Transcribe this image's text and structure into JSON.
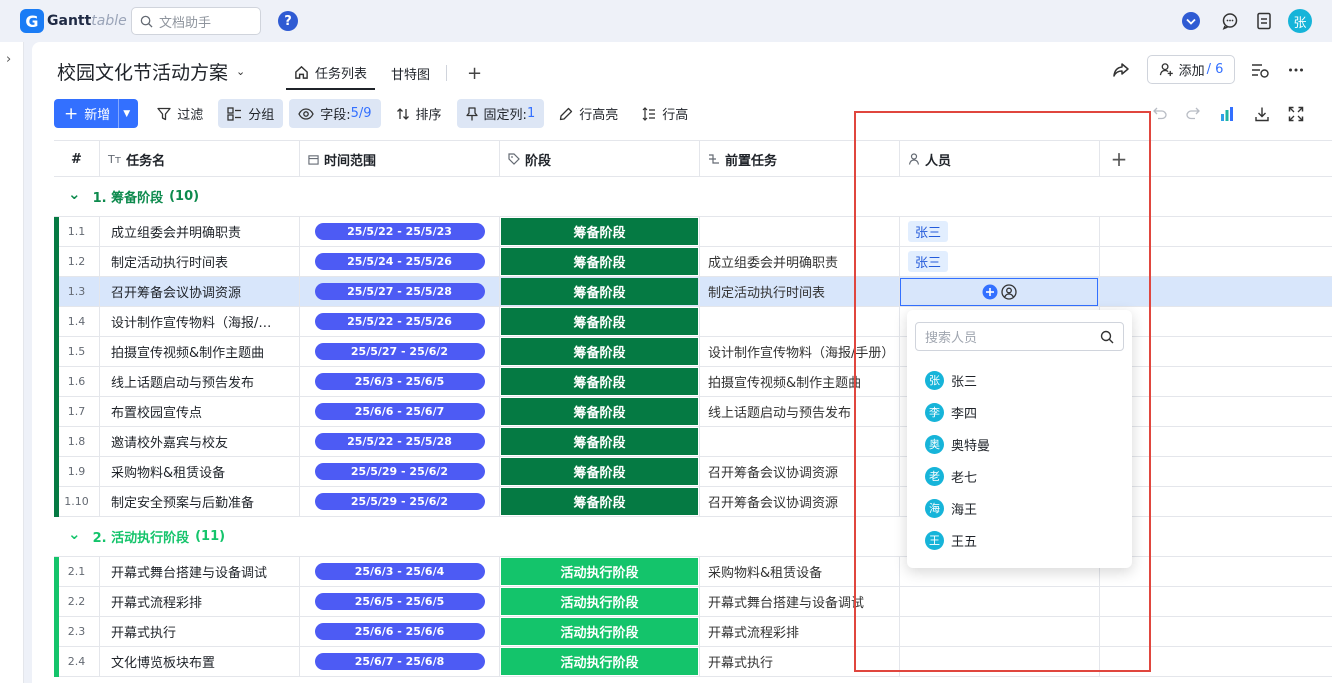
{
  "app": {
    "logo_letter": "G",
    "logo_part1": "Gantt",
    "logo_part2": "table",
    "search_placeholder": "文档助手",
    "help": "?",
    "user_avatar": "张"
  },
  "doc": {
    "title": "校园文化节活动方案",
    "tabs": [
      "任务列表",
      "甘特图"
    ],
    "add_label": "添加",
    "add_count": "/ 6"
  },
  "toolbar": {
    "new": "新增",
    "filter": "过滤",
    "group": "分组",
    "fields": "字段:",
    "fields_value": "5/9",
    "sort": "排序",
    "pin": "固定列:",
    "pin_value": "1",
    "row_highlight": "行高亮",
    "row_height": "行高"
  },
  "columns": [
    "#",
    "任务名",
    "时间范围",
    "阶段",
    "前置任务",
    "人员"
  ],
  "colors": {
    "stage1": "#057a43",
    "stage2": "#14c46b",
    "accent": "#3370ff",
    "date_pill": "#4d5bf4"
  },
  "groups": [
    {
      "label": "1. 筹备阶段",
      "count": "(10)",
      "color": "#0d8a4d"
    },
    {
      "label": "2. 活动执行阶段",
      "count": "(11)",
      "color": "#14c46b"
    }
  ],
  "rows": [
    {
      "idx": "1.1",
      "name": "成立组委会并明确职责",
      "time": "25/5/22 - 25/5/23",
      "stage": "筹备阶段",
      "pre": "",
      "person": "张三"
    },
    {
      "idx": "1.2",
      "name": "制定活动执行时间表",
      "time": "25/5/24 - 25/5/26",
      "stage": "筹备阶段",
      "pre": "成立组委会并明确职责",
      "person": "张三"
    },
    {
      "idx": "1.3",
      "name": "召开筹备会议协调资源",
      "time": "25/5/27 - 25/5/28",
      "stage": "筹备阶段",
      "pre": "制定活动执行时间表",
      "person": ""
    },
    {
      "idx": "1.4",
      "name": "设计制作宣传物料（海报/…",
      "time": "25/5/22 - 25/5/26",
      "stage": "筹备阶段",
      "pre": "",
      "person": ""
    },
    {
      "idx": "1.5",
      "name": "拍摄宣传视频&制作主题曲",
      "time": "25/5/27 - 25/6/2",
      "stage": "筹备阶段",
      "pre": "设计制作宣传物料（海报/手册）",
      "person": ""
    },
    {
      "idx": "1.6",
      "name": "线上话题启动与预告发布",
      "time": "25/6/3 - 25/6/5",
      "stage": "筹备阶段",
      "pre": "拍摄宣传视频&制作主题曲",
      "person": ""
    },
    {
      "idx": "1.7",
      "name": "布置校园宣传点",
      "time": "25/6/6 - 25/6/7",
      "stage": "筹备阶段",
      "pre": "线上话题启动与预告发布",
      "person": ""
    },
    {
      "idx": "1.8",
      "name": "邀请校外嘉宾与校友",
      "time": "25/5/22 - 25/5/28",
      "stage": "筹备阶段",
      "pre": "",
      "person": ""
    },
    {
      "idx": "1.9",
      "name": "采购物料&租赁设备",
      "time": "25/5/29 - 25/6/2",
      "stage": "筹备阶段",
      "pre": "召开筹备会议协调资源",
      "person": ""
    },
    {
      "idx": "1.10",
      "name": "制定安全预案与后勤准备",
      "time": "25/5/29 - 25/6/2",
      "stage": "筹备阶段",
      "pre": "召开筹备会议协调资源",
      "person": ""
    },
    {
      "idx": "2.1",
      "name": "开幕式舞台搭建与设备调试",
      "time": "25/6/3 - 25/6/4",
      "stage": "活动执行阶段",
      "pre": "采购物料&租赁设备",
      "person": ""
    },
    {
      "idx": "2.2",
      "name": "开幕式流程彩排",
      "time": "25/6/5 - 25/6/5",
      "stage": "活动执行阶段",
      "pre": "开幕式舞台搭建与设备调试",
      "person": ""
    },
    {
      "idx": "2.3",
      "name": "开幕式执行",
      "time": "25/6/6 - 25/6/6",
      "stage": "活动执行阶段",
      "pre": "开幕式流程彩排",
      "person": ""
    },
    {
      "idx": "2.4",
      "name": "文化博览板块布置",
      "time": "25/6/7 - 25/6/8",
      "stage": "活动执行阶段",
      "pre": "开幕式执行",
      "person": ""
    }
  ],
  "picker": {
    "placeholder": "搜索人员",
    "people": [
      {
        "avatar": "张",
        "name": "张三"
      },
      {
        "avatar": "李",
        "name": "李四"
      },
      {
        "avatar": "奥",
        "name": "奥特曼"
      },
      {
        "avatar": "老",
        "name": "老七"
      },
      {
        "avatar": "海",
        "name": "海王"
      },
      {
        "avatar": "王",
        "name": "王五"
      }
    ]
  }
}
